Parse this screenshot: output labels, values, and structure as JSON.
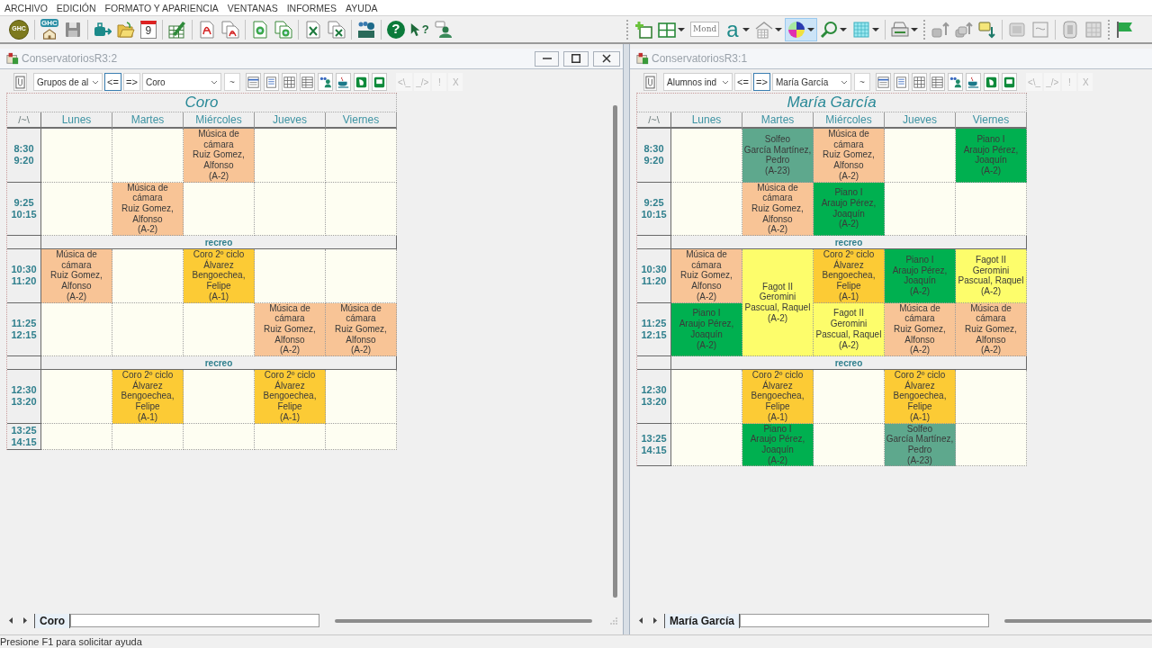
{
  "menu": [
    "ARCHIVO",
    "EDICIÓN",
    "FORMATO Y APARIENCIA",
    "VENTANAS",
    "INFORMES",
    "AYUDA"
  ],
  "toolbar": {
    "main": [
      {
        "pressed": false,
        "label": "GHC"
      },
      {
        "pressed": false,
        "label": "GHC"
      },
      {
        "pressed": false
      },
      {
        "pressed": false
      },
      {
        "pressed": false
      },
      {
        "pressed": false,
        "label": "9"
      },
      {
        "pressed": false
      },
      {
        "pressed": false
      },
      {
        "pressed": false
      },
      {
        "pressed": false
      },
      {
        "pressed": false
      },
      {
        "pressed": false
      },
      {
        "pressed": false
      },
      {
        "pressed": false
      },
      {
        "pressed": false,
        "label": "?"
      },
      {
        "pressed": false,
        "label": "?"
      },
      {
        "pressed": false
      }
    ],
    "format": [
      {
        "pressed": false
      },
      {
        "pressed": false
      },
      {
        "pressed": false,
        "label": "Mond"
      },
      {
        "pressed": false,
        "label": "a"
      },
      {
        "pressed": false
      },
      {
        "pressed": true
      },
      {
        "pressed": false
      },
      {
        "pressed": false
      },
      {
        "pressed": false
      },
      {
        "pressed": false
      },
      {
        "pressed": false
      },
      {
        "pressed": false
      },
      {
        "pressed": false
      },
      {
        "pressed": false
      },
      {
        "pressed": false
      },
      {
        "pressed": false
      },
      {
        "pressed": false
      }
    ]
  },
  "windows": [
    {
      "title": "ConservatoriosR3:2",
      "cut_off_right": false,
      "view_select": "Grupos de al",
      "nav_buttons": [
        {
          "label": "<=",
          "selected": true
        },
        {
          "label": "=>",
          "selected": false
        }
      ],
      "item_select": "Coro",
      "mode_button": "~",
      "tool_buttons": [
        {
          "label": "<\\_",
          "disabled": true
        },
        {
          "label": "_/>",
          "disabled": true
        },
        {
          "label": "!",
          "disabled": true
        },
        {
          "label": "X",
          "disabled": true
        }
      ],
      "timetable": {
        "title": "Coro",
        "corner": "/~\\",
        "days": [
          "Lunes",
          "Martes",
          "Miércoles",
          "Jueves",
          "Viernes"
        ],
        "rows": [
          {
            "kind": "period",
            "start": "8:30",
            "end": "9:20",
            "cells": [
              {
                "kind": "empty"
              },
              {
                "kind": "empty"
              },
              {
                "kind": "lesson",
                "subject": "Música de cámara",
                "teacher": "Ruiz Gomez, Alfonso",
                "room": "(A-2)",
                "color": "#f8c496"
              },
              {
                "kind": "empty"
              },
              {
                "kind": "empty"
              }
            ]
          },
          {
            "kind": "period",
            "start": "9:25",
            "end": "10:15",
            "cells": [
              {
                "kind": "empty"
              },
              {
                "kind": "lesson",
                "subject": "Música de cámara",
                "teacher": "Ruiz Gomez, Alfonso",
                "room": "(A-2)",
                "color": "#f8c496"
              },
              {
                "kind": "empty"
              },
              {
                "kind": "empty"
              },
              {
                "kind": "empty"
              }
            ]
          },
          {
            "kind": "break",
            "label": "recreo"
          },
          {
            "kind": "period",
            "start": "10:30",
            "end": "11:20",
            "cells": [
              {
                "kind": "lesson",
                "subject": "Música de cámara",
                "teacher": "Ruiz Gomez, Alfonso",
                "room": "(A-2)",
                "color": "#f8c496"
              },
              {
                "kind": "empty"
              },
              {
                "kind": "lesson",
                "subject": "Coro 2º ciclo",
                "teacher": "Álvarez Bengoechea, Felipe",
                "room": "(A-1)",
                "color": "#fccb35"
              },
              {
                "kind": "empty"
              },
              {
                "kind": "empty"
              }
            ]
          },
          {
            "kind": "period",
            "start": "11:25",
            "end": "12:15",
            "cells": [
              {
                "kind": "empty"
              },
              {
                "kind": "empty"
              },
              {
                "kind": "empty"
              },
              {
                "kind": "lesson",
                "subject": "Música de cámara",
                "teacher": "Ruiz Gomez, Alfonso",
                "room": "(A-2)",
                "color": "#f8c496"
              },
              {
                "kind": "lesson",
                "subject": "Música de cámara",
                "teacher": "Ruiz Gomez, Alfonso",
                "room": "(A-2)",
                "color": "#f8c496"
              }
            ]
          },
          {
            "kind": "break",
            "label": "recreo"
          },
          {
            "kind": "period",
            "start": "12:30",
            "end": "13:20",
            "cells": [
              {
                "kind": "empty"
              },
              {
                "kind": "lesson",
                "subject": "Coro 2º ciclo",
                "teacher": "Álvarez Bengoechea, Felipe",
                "room": "(A-1)",
                "color": "#fccb35"
              },
              {
                "kind": "empty"
              },
              {
                "kind": "lesson",
                "subject": "Coro 2º ciclo",
                "teacher": "Álvarez Bengoechea, Felipe",
                "room": "(A-1)",
                "color": "#fccb35"
              },
              {
                "kind": "empty"
              }
            ]
          },
          {
            "kind": "period",
            "start": "13:25",
            "end": "14:15",
            "cells": [
              {
                "kind": "empty"
              },
              {
                "kind": "empty"
              },
              {
                "kind": "empty"
              },
              {
                "kind": "empty"
              },
              {
                "kind": "empty"
              }
            ]
          }
        ]
      },
      "sheet_tabs": [
        {
          "label": "Coro",
          "selected": true
        }
      ]
    },
    {
      "title": "ConservatoriosR3:1",
      "cut_off_right": true,
      "view_select": "Alumnos ind",
      "nav_buttons": [
        {
          "label": "<=",
          "selected": false
        },
        {
          "label": "=>",
          "selected": true
        }
      ],
      "item_select": "María García",
      "mode_button": "~",
      "tool_buttons": [
        {
          "label": "<\\_",
          "disabled": true
        },
        {
          "label": "_/>",
          "disabled": true
        },
        {
          "label": "!",
          "disabled": true
        },
        {
          "label": "X",
          "disabled": true
        }
      ],
      "timetable": {
        "title": "María García",
        "corner": "/~\\",
        "days": [
          "Lunes",
          "Martes",
          "Miércoles",
          "Jueves",
          "Viernes"
        ],
        "rows": [
          {
            "kind": "period",
            "start": "8:30",
            "end": "9:20",
            "cells": [
              {
                "kind": "empty"
              },
              {
                "kind": "lesson",
                "subject": "Solfeo",
                "teacher": "García Martínez, Pedro",
                "room": "(A-23)",
                "color": "#5ea88d"
              },
              {
                "kind": "lesson",
                "subject": "Música de cámara",
                "teacher": "Ruiz Gomez, Alfonso",
                "room": "(A-2)",
                "color": "#f8c496"
              },
              {
                "kind": "empty"
              },
              {
                "kind": "lesson",
                "subject": "Piano I",
                "teacher": "Araujo Pérez, Joaquín",
                "room": "(A-2)",
                "color": "#00b050"
              }
            ]
          },
          {
            "kind": "period",
            "start": "9:25",
            "end": "10:15",
            "cells": [
              {
                "kind": "empty"
              },
              {
                "kind": "lesson",
                "subject": "Música de cámara",
                "teacher": "Ruiz Gomez, Alfonso",
                "room": "(A-2)",
                "color": "#f8c496"
              },
              {
                "kind": "lesson",
                "subject": "Piano I",
                "teacher": "Araujo Pérez, Joaquín",
                "room": "(A-2)",
                "color": "#00b050"
              },
              {
                "kind": "empty"
              },
              {
                "kind": "empty"
              }
            ]
          },
          {
            "kind": "break",
            "label": "recreo"
          },
          {
            "kind": "period",
            "start": "10:30",
            "end": "11:20",
            "cells": [
              {
                "kind": "lesson",
                "subject": "Música de cámara",
                "teacher": "Ruiz Gomez, Alfonso",
                "room": "(A-2)",
                "color": "#f8c496"
              },
              {
                "kind": "double",
                "subject": "Fagot II",
                "teacher": "Geromini Pascual, Raquel",
                "room": "(A-2)",
                "color": "#fdfd6b"
              },
              {
                "kind": "lesson",
                "subject": "Coro 2º ciclo",
                "teacher": "Álvarez Bengoechea, Felipe",
                "room": "(A-1)",
                "color": "#fccb35"
              },
              {
                "kind": "lesson",
                "subject": "Piano I",
                "teacher": "Araujo Pérez, Joaquín",
                "room": "(A-2)",
                "color": "#00b050"
              },
              {
                "kind": "lesson",
                "subject": "Fagot II",
                "teacher": "Geromini Pascual, Raquel",
                "room": "(A-2)",
                "color": "#fdfd6b"
              }
            ]
          },
          {
            "kind": "period",
            "start": "11:25",
            "end": "12:15",
            "cells": [
              {
                "kind": "lesson",
                "subject": "Piano I",
                "teacher": "Araujo Pérez, Joaquín",
                "room": "(A-2)",
                "color": "#00b050"
              },
              {
                "kind": "lesson",
                "subject": "Fagot II",
                "teacher": "Geromini Pascual, Raquel",
                "room": "(A-2)",
                "color": "#fdfd6b"
              },
              {
                "kind": "lesson",
                "subject": "Música de cámara",
                "teacher": "Ruiz Gomez, Alfonso",
                "room": "(A-2)",
                "color": "#f8c496"
              },
              {
                "kind": "lesson",
                "subject": "Música de cámara",
                "teacher": "Ruiz Gomez, Alfonso",
                "room": "(A-2)",
                "color": "#f8c496"
              }
            ]
          },
          {
            "kind": "break",
            "label": "recreo"
          },
          {
            "kind": "period",
            "start": "12:30",
            "end": "13:20",
            "cells": [
              {
                "kind": "empty"
              },
              {
                "kind": "lesson",
                "subject": "Coro 2º ciclo",
                "teacher": "Álvarez Bengoechea, Felipe",
                "room": "(A-1)",
                "color": "#fccb35"
              },
              {
                "kind": "empty"
              },
              {
                "kind": "lesson",
                "subject": "Coro 2º ciclo",
                "teacher": "Álvarez Bengoechea, Felipe",
                "room": "(A-1)",
                "color": "#fccb35"
              },
              {
                "kind": "empty"
              }
            ]
          },
          {
            "kind": "period",
            "start": "13:25",
            "end": "14:15",
            "cells": [
              {
                "kind": "empty"
              },
              {
                "kind": "lesson",
                "subject": "Piano I",
                "teacher": "Araujo Pérez, Joaquín",
                "room": "(A-2)",
                "color": "#00b050"
              },
              {
                "kind": "empty"
              },
              {
                "kind": "lesson",
                "subject": "Solfeo",
                "teacher": "García Martínez, Pedro",
                "room": "(A-23)",
                "color": "#5ea88d"
              },
              {
                "kind": "empty"
              }
            ]
          }
        ]
      },
      "sheet_tabs": [
        {
          "label": "María García",
          "selected": true
        }
      ]
    }
  ],
  "status_bar": "Presione F1 para solicitar ayuda"
}
